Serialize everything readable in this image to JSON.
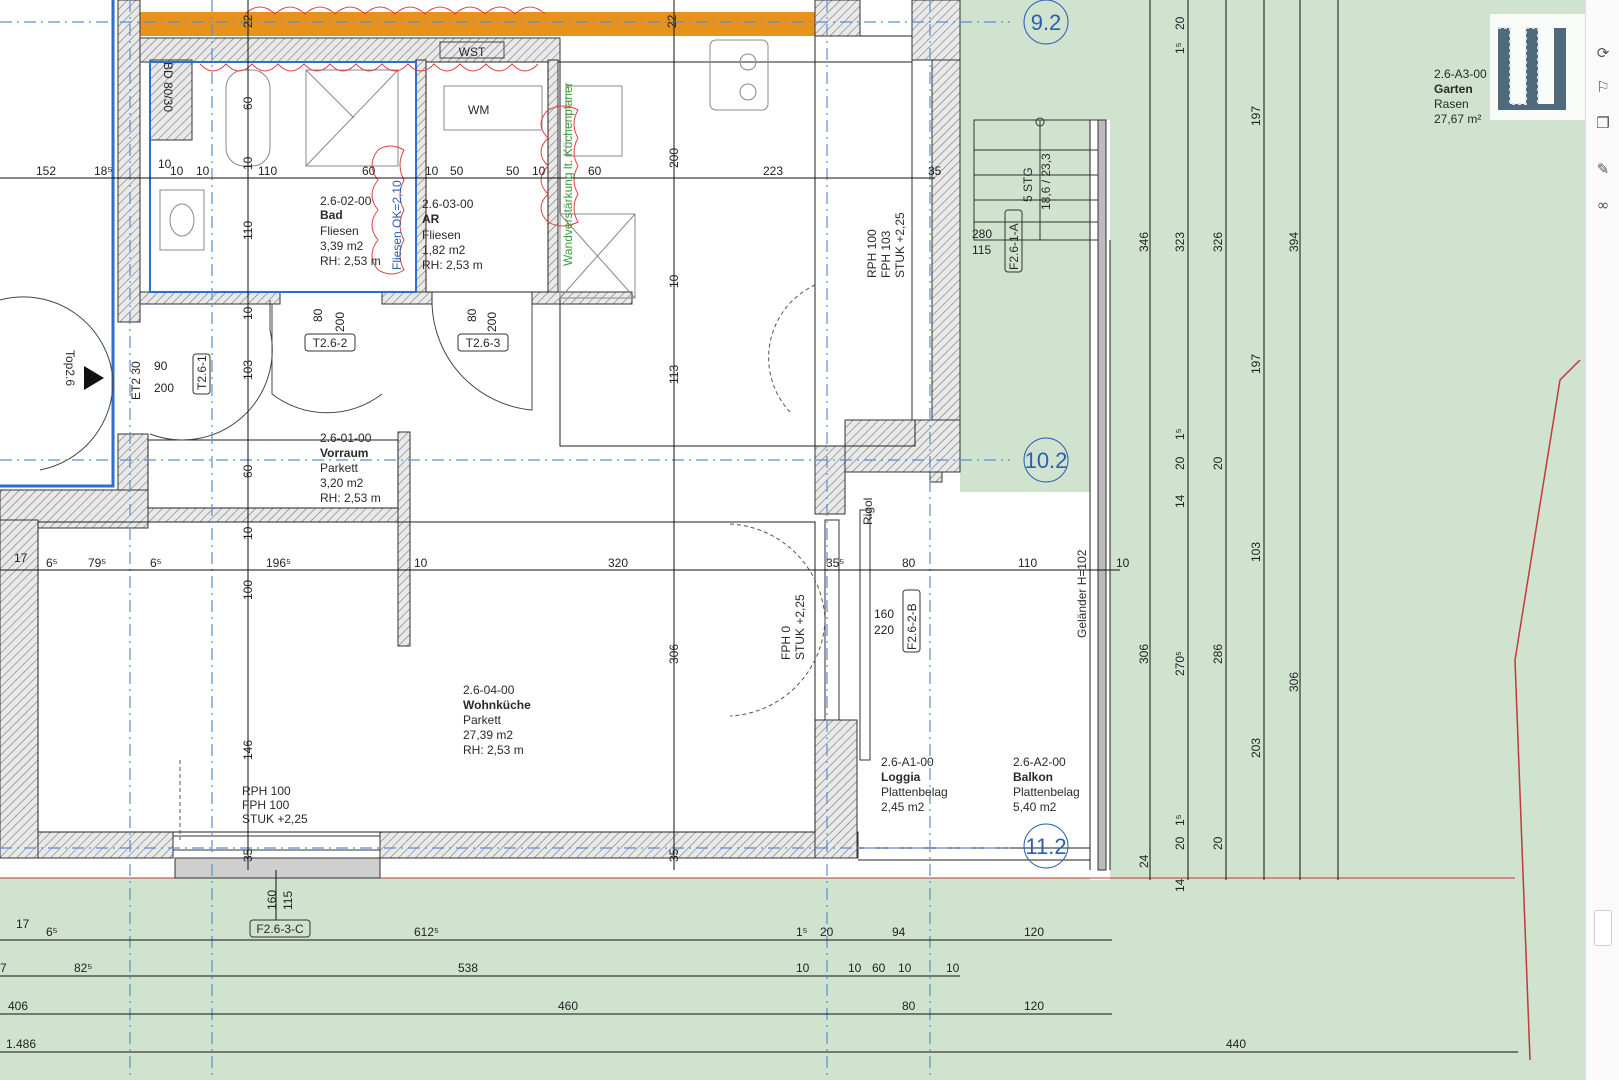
{
  "axes": {
    "a1": "9.2",
    "a2": "10.2",
    "a3": "11.2"
  },
  "wm": "WM",
  "top": "Top2.6",
  "garden": {
    "id": "2.6-A3-00",
    "name": "Garten",
    "floor": "Rasen",
    "area": "27,67 m²"
  },
  "rooms": {
    "bad": {
      "id": "2.6-02-00",
      "name": "Bad",
      "floor": "Fliesen",
      "area": "3,39 m2",
      "rh": "RH: 2,53 m"
    },
    "ar": {
      "id": "2.6-03-00",
      "name": "AR",
      "floor": "Fliesen",
      "area": "1,82 m2",
      "rh": "RH: 2,53 m"
    },
    "vorraum": {
      "id": "2.6-01-00",
      "name": "Vorraum",
      "floor": "Parkett",
      "area": "3,20 m2",
      "rh": "RH: 2,53 m"
    },
    "wohn": {
      "id": "2.6-04-00",
      "name": "Wohnküche",
      "floor": "Parkett",
      "area": "27,39 m2",
      "rh": "RH: 2,53 m"
    },
    "loggia": {
      "id": "2.6-A1-00",
      "name": "Loggia",
      "floor": "Plattenbelag",
      "area": "2,45 m2"
    },
    "balkon": {
      "id": "2.6-A2-00",
      "name": "Balkon",
      "floor": "Plattenbelag",
      "area": "5,40 m2"
    }
  },
  "notes": {
    "fliesen": "Fliesen OK=2,10",
    "wand": "Wandverstärkung lt. Küchenplaner",
    "rigol": "Rigol",
    "gel": "Geländer H=102",
    "stg": "5 STG",
    "stg1": "18,6 / 23,3",
    "bd": "BD 80/30",
    "et": "ET2 30",
    "wst": "WST"
  },
  "windows": {
    "w1": [
      "RPH 100",
      "FPH 103",
      "STUK +2,25"
    ],
    "w2": [
      "FPH 0",
      "STUK +2,25"
    ],
    "w3": [
      "RPH 100",
      "FPH 100",
      "STUK +2,25"
    ]
  },
  "tags": {
    "t1": "T2.6-2",
    "t2": "T2.6-3",
    "t3": "T2.6-1",
    "f1": "F2.6-1-A",
    "f2": "F2.6-2-B",
    "f3": "F2.6-3-C"
  },
  "dims": {
    "row1": [
      "152",
      "18⁵",
      "10",
      "10",
      "110",
      "60",
      "10",
      "50",
      "50",
      "10",
      "60",
      "223",
      "35"
    ],
    "row2": [
      "17",
      "6⁵",
      "79⁵",
      "6⁵",
      "196⁵",
      "10",
      "320",
      "35⁵",
      "80",
      "110",
      "10"
    ],
    "bot1": [
      "17",
      "6⁵",
      "612⁵",
      "1⁵",
      "20",
      "94",
      "120"
    ],
    "bot2": [
      "7",
      "82⁵",
      "538",
      "10",
      "10",
      "60",
      "10",
      "10"
    ],
    "bot3": [
      "406",
      "460",
      "80",
      "120"
    ],
    "bot4": [
      "1.486",
      "440"
    ],
    "vert": [
      "22",
      "22",
      "60",
      "10",
      "110",
      "10",
      "103",
      "60",
      "10",
      "100",
      "146",
      "35",
      "200",
      "10",
      "113",
      "306",
      "35",
      "10",
      "90",
      "200",
      "80",
      "200",
      "80",
      "200",
      "160",
      "115",
      "160",
      "220",
      "280",
      "115"
    ],
    "right": [
      "20",
      "1⁵",
      "346",
      "323",
      "326",
      "394",
      "197",
      "197",
      "20",
      "1⁵",
      "20",
      "14",
      "306",
      "270⁵",
      "286",
      "103",
      "306",
      "203",
      "20",
      "1⁵",
      "20",
      "24",
      "14"
    ]
  },
  "colors": {
    "garden": "#cfe3cf",
    "axis": "#2b5fb0",
    "orange": "#e8921e",
    "revision": "#e04040"
  }
}
